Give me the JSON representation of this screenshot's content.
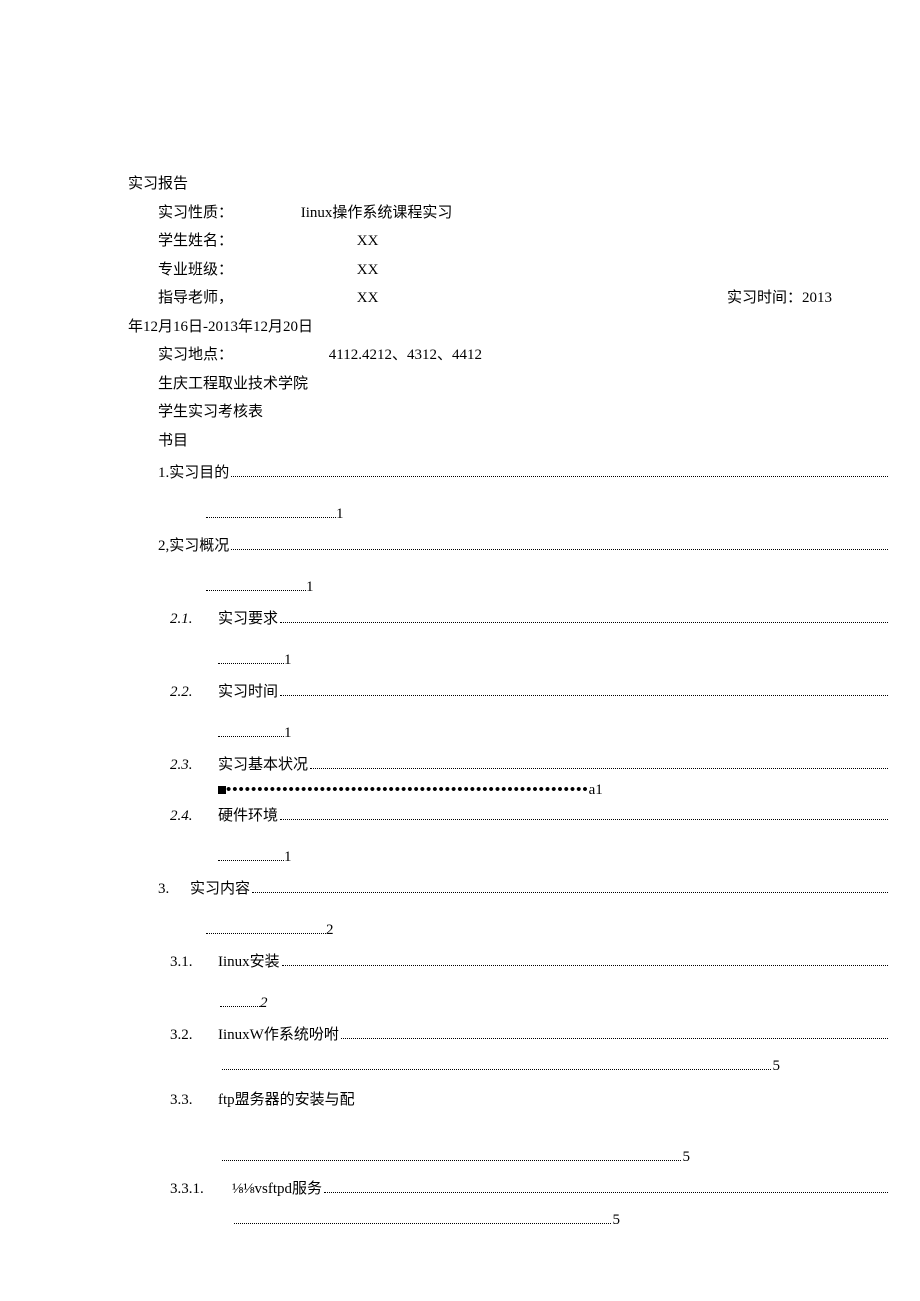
{
  "header": {
    "title": "实习报告",
    "nature_label": "实习性质：",
    "nature_value": "Iinux操作系统课程实习",
    "name_label": "学生姓名：",
    "name_value": "XX",
    "class_label": "专业班级：",
    "class_value": "XX",
    "teacher_label": "指导老师，",
    "teacher_value": "XX",
    "time_label": "实习时间：2013",
    "time_wrap": "年12月16日-2013年12月20日",
    "place_label": "实习地点：",
    "place_value": "4112.4212、4312、4412",
    "org": "生庆工程取业技术学院",
    "table_title": "学生实习考核表",
    "toc_heading": "书目"
  },
  "toc": {
    "i1": {
      "label": "1.实习目的",
      "cont": "1"
    },
    "i2": {
      "label": "2,实习概况",
      "cont": "1"
    },
    "i21": {
      "num": "2.1.",
      "label": "实习要求",
      "cont": "1"
    },
    "i22": {
      "num": "2.2.",
      "label": "实习时间",
      "cont": "1"
    },
    "i23": {
      "num": "2.3.",
      "label": "实习基本状况",
      "cont": "a1"
    },
    "i23dots": "••••••••••••••••••••••••••••••••••••••••••••••••••••••••••",
    "i24": {
      "num": "2.4.",
      "label": "硬件环境",
      "cont": "1"
    },
    "i3": {
      "num": "3.",
      "label": "实习内容",
      "cont": "2"
    },
    "i31": {
      "num": "3.1.",
      "label": "Iinux安装",
      "cont": "2"
    },
    "i32": {
      "num": "3.2.",
      "label": "IinuxW作系统吩咐",
      "cont": "5"
    },
    "i33": {
      "num": "3.3.",
      "label": "ftp盟务器的安装与配",
      "cont": "5"
    },
    "i331": {
      "num": "3.3.1.",
      "label": "⅛⅛vsftpd服务",
      "cont": "5"
    }
  }
}
